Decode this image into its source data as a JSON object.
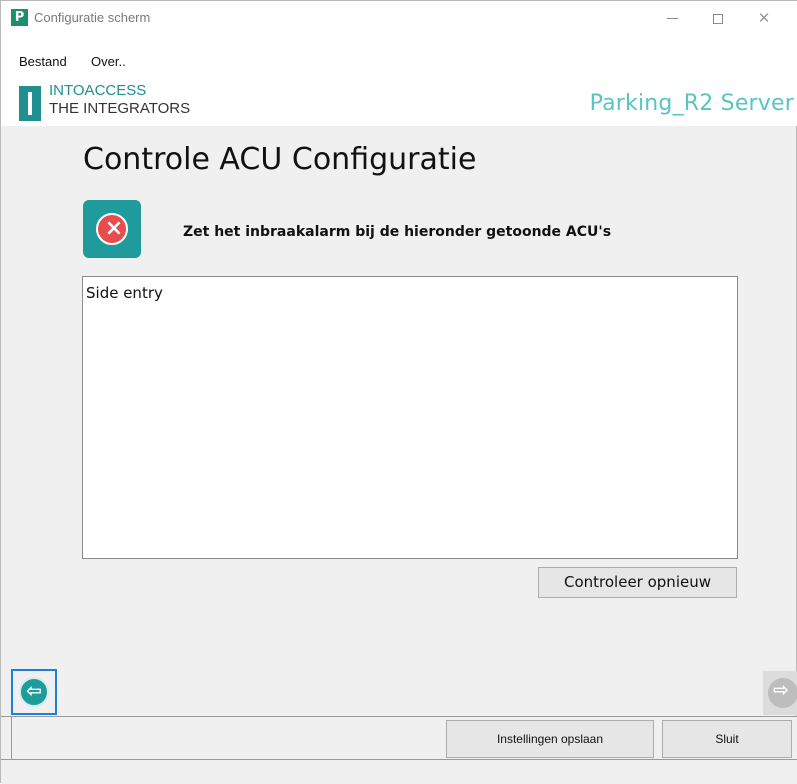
{
  "window": {
    "title": "Configuratie scherm",
    "app_icon_letter": "P"
  },
  "menu": {
    "items": [
      "Bestand",
      "Over.."
    ]
  },
  "brand": {
    "line1": "INTOACCESS",
    "line2": "THE INTEGRATORS",
    "server": "Parking_R2 Server"
  },
  "content": {
    "title": "Controle ACU Configuratie",
    "status_icon": "error-icon",
    "message": "Zet het inbraakalarm bij de hieronder getoonde ACU's",
    "list_items": [
      "Side entry"
    ],
    "recheck_label": "Controleer opnieuw"
  },
  "navigation": {
    "prev_icon": "arrow-left-icon",
    "next_icon": "arrow-right-icon"
  },
  "footer": {
    "save_label": "Instellingen opslaan",
    "close_label": "Sluit"
  },
  "colors": {
    "brand_teal": "#1f9b9b",
    "error_red": "#e84c4c",
    "server_text": "#58c4c4",
    "focus_blue": "#1e7fd8"
  }
}
